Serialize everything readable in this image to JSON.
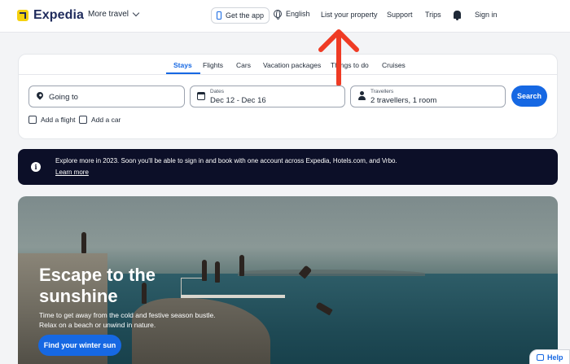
{
  "header": {
    "brand": "Expedia",
    "more_travel": "More travel",
    "get_app": "Get the app",
    "language": "English",
    "list_property": "List your property",
    "support": "Support",
    "trips": "Trips",
    "sign_in": "Sign in",
    "icons": [
      "expedia-logo",
      "chevron-down-icon",
      "phone-icon",
      "globe-icon",
      "bell-icon"
    ]
  },
  "search": {
    "tabs": [
      {
        "label": "Stays",
        "active": true
      },
      {
        "label": "Flights",
        "active": false
      },
      {
        "label": "Cars",
        "active": false
      },
      {
        "label": "Vacation packages",
        "active": false
      },
      {
        "label": "Things to do",
        "active": false
      },
      {
        "label": "Cruises",
        "active": false
      }
    ],
    "going_to_placeholder": "Going to",
    "dates_label": "Dates",
    "dates_value": "Dec 12 - Dec 16",
    "travellers_label": "Travellers",
    "travellers_value": "2 travellers, 1 room",
    "search_button": "Search",
    "add_flight": "Add a flight",
    "add_car": "Add a car",
    "accent_color": "#1668e3"
  },
  "banner": {
    "text": "Explore more in 2023. Soon you'll be able to sign in and book with one account across Expedia, Hotels.com, and Vrbo.",
    "link": "Learn more",
    "icon": "info-icon"
  },
  "hero": {
    "title": "Escape to the sunshine",
    "subtitle": "Time to get away from the cold and festive season bustle. Relax on a beach or unwind in nature.",
    "button": "Find your winter sun"
  },
  "help": {
    "label": "Help",
    "icon": "chat-icon"
  },
  "annotation": {
    "type": "red-arrow",
    "color": "#ef3b24"
  }
}
